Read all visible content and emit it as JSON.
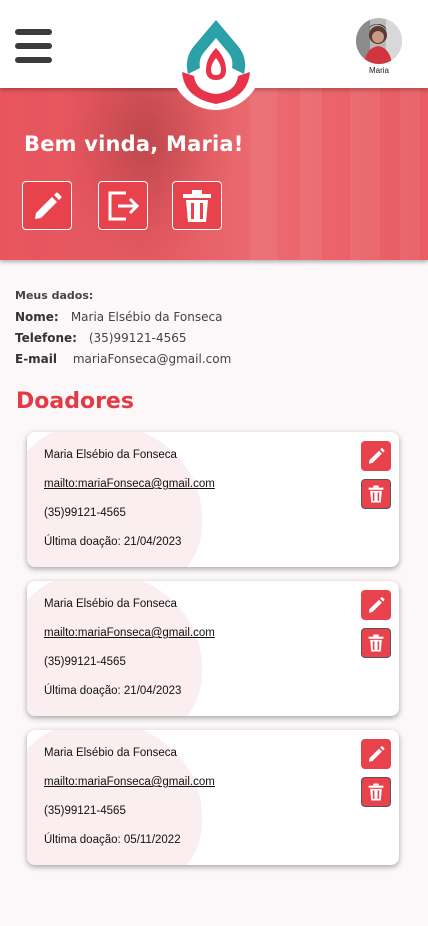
{
  "header": {
    "avatar_name": "Maria"
  },
  "hero": {
    "welcome": "Bem vinda, Maria!"
  },
  "my_data": {
    "title": "Meus dados:",
    "fields": [
      {
        "label": "Nome:",
        "value": "Maria Elsébio da Fonseca"
      },
      {
        "label": "Telefone:",
        "value": "(35)99121-4565"
      },
      {
        "label": "E-mail",
        "value": "mariaFonseca@gmail.com"
      }
    ]
  },
  "donors": {
    "title": "Doadores",
    "items": [
      {
        "name": "Maria Elsébio da Fonseca",
        "email": "mailto:mariaFonseca@gmail.com",
        "phone": "(35)99121-4565",
        "last_donation": "Última doação: 21/04/2023"
      },
      {
        "name": "Maria Elsébio da Fonseca",
        "email": "mailto:mariaFonseca@gmail.com",
        "phone": "(35)99121-4565",
        "last_donation": "Última doação: 21/04/2023"
      },
      {
        "name": "Maria Elsébio da Fonseca",
        "email": "mailto:mariaFonseca@gmail.com",
        "phone": "(35)99121-4565",
        "last_donation": "Última doação: 05/11/2022"
      }
    ]
  },
  "icons": {
    "menu": "hamburger-menu-icon",
    "logo": "blood-drop-logo",
    "edit": "pencil-icon",
    "logout": "logout-icon",
    "delete": "trash-icon"
  },
  "colors": {
    "accent": "#e8434c",
    "title": "#e33b43",
    "logo_teal": "#2ba0a8",
    "logo_red": "#e8344a"
  }
}
